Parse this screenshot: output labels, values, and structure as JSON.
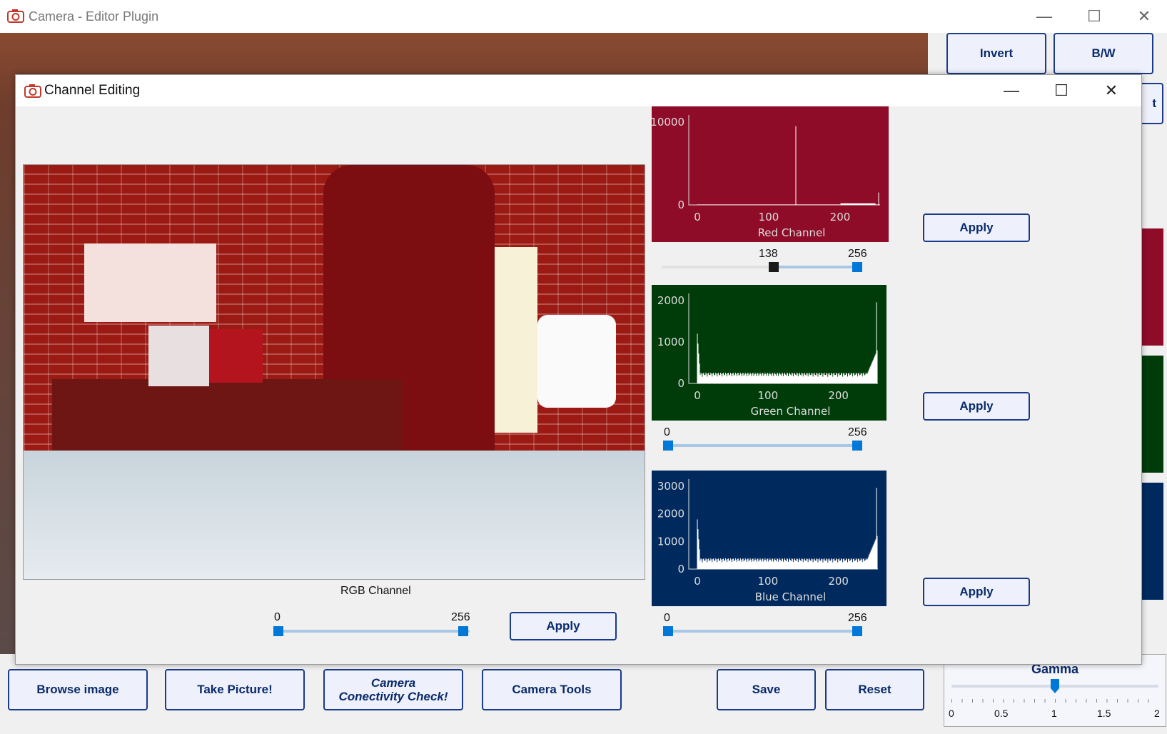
{
  "window": {
    "title": "Camera - Editor Plugin",
    "minimize": "—",
    "maximize": "☐",
    "close": "✕"
  },
  "side_buttons": {
    "invert": "Invert",
    "bw": "B/W",
    "partial_label": "t"
  },
  "bottom_buttons": {
    "browse": "Browse image",
    "take_picture": "Take Picture!",
    "conn_check_line1": "Camera",
    "conn_check_line2": "Conectivity Check!",
    "camera_tools": "Camera Tools",
    "save": "Save",
    "reset": "Reset"
  },
  "gamma": {
    "label": "Gamma",
    "value": 1,
    "min": 0,
    "max": 2,
    "ticks": [
      "0",
      "0.5",
      "1",
      "1.5",
      "2"
    ]
  },
  "dialog": {
    "title": "Channel Editing",
    "minimize": "—",
    "maximize": "☐",
    "close": "✕",
    "rgb": {
      "label": "RGB Channel",
      "min_label": "0",
      "max_label": "256",
      "low": 0,
      "high": 256,
      "apply": "Apply"
    },
    "red": {
      "title": "Red Channel",
      "color": "#8e0c28",
      "y_ticks": [
        "10000",
        "0"
      ],
      "x_ticks": [
        "0",
        "100",
        "200"
      ],
      "min_label": "138",
      "max_label": "256",
      "low": 138,
      "high": 256,
      "apply": "Apply"
    },
    "green": {
      "title": "Green Channel",
      "color": "#003c0a",
      "y_ticks": [
        "2000",
        "1000",
        "0"
      ],
      "x_ticks": [
        "0",
        "100",
        "200"
      ],
      "min_label": "0",
      "max_label": "256",
      "low": 0,
      "high": 256,
      "apply": "Apply"
    },
    "blue": {
      "title": "Blue Channel",
      "color": "#002a5e",
      "y_ticks": [
        "3000",
        "2000",
        "1000",
        "0"
      ],
      "x_ticks": [
        "0",
        "100",
        "200"
      ],
      "min_label": "0",
      "max_label": "256",
      "low": 0,
      "high": 256,
      "apply": "Apply"
    }
  }
}
